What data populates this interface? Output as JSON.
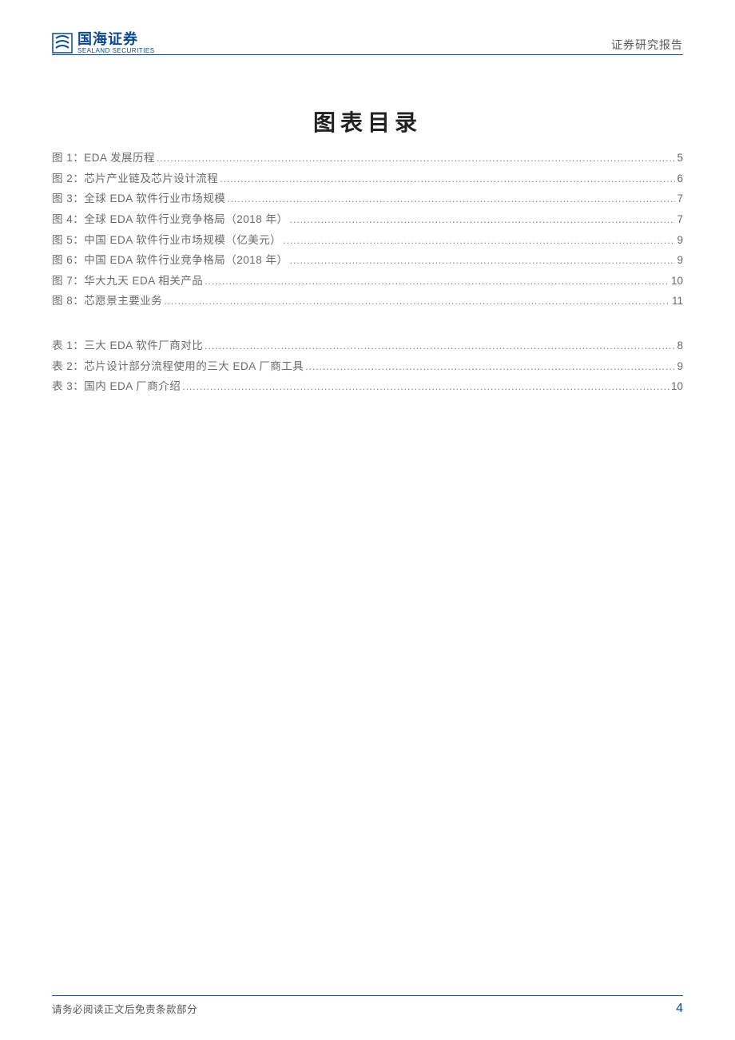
{
  "header": {
    "logo_cn": "国海证券",
    "logo_en": "SEALAND SECURITIES",
    "report_label": "证券研究报告"
  },
  "title": "图表目录",
  "figures": [
    {
      "label": "图 1：EDA 发展历程",
      "page": "5"
    },
    {
      "label": "图 2：芯片产业链及芯片设计流程",
      "page": "6"
    },
    {
      "label": "图 3：全球 EDA 软件行业市场规模",
      "page": "7"
    },
    {
      "label": "图 4：全球 EDA 软件行业竞争格局（2018 年）",
      "page": "7"
    },
    {
      "label": "图 5：中国 EDA 软件行业市场规模（亿美元）",
      "page": "9"
    },
    {
      "label": "图 6：中国 EDA 软件行业竞争格局（2018 年）",
      "page": "9"
    },
    {
      "label": "图 7：华大九天 EDA 相关产品",
      "page": "10"
    },
    {
      "label": "图 8：芯愿景主要业务",
      "page": "11"
    }
  ],
  "tables": [
    {
      "label": "表 1：三大 EDA 软件厂商对比",
      "page": "8"
    },
    {
      "label": "表 2：芯片设计部分流程使用的三大 EDA 厂商工具",
      "page": "9"
    },
    {
      "label": "表 3：国内 EDA 厂商介绍",
      "page": "10"
    }
  ],
  "footer": {
    "disclaimer": "请务必阅读正文后免责条款部分",
    "page_number": "4"
  }
}
